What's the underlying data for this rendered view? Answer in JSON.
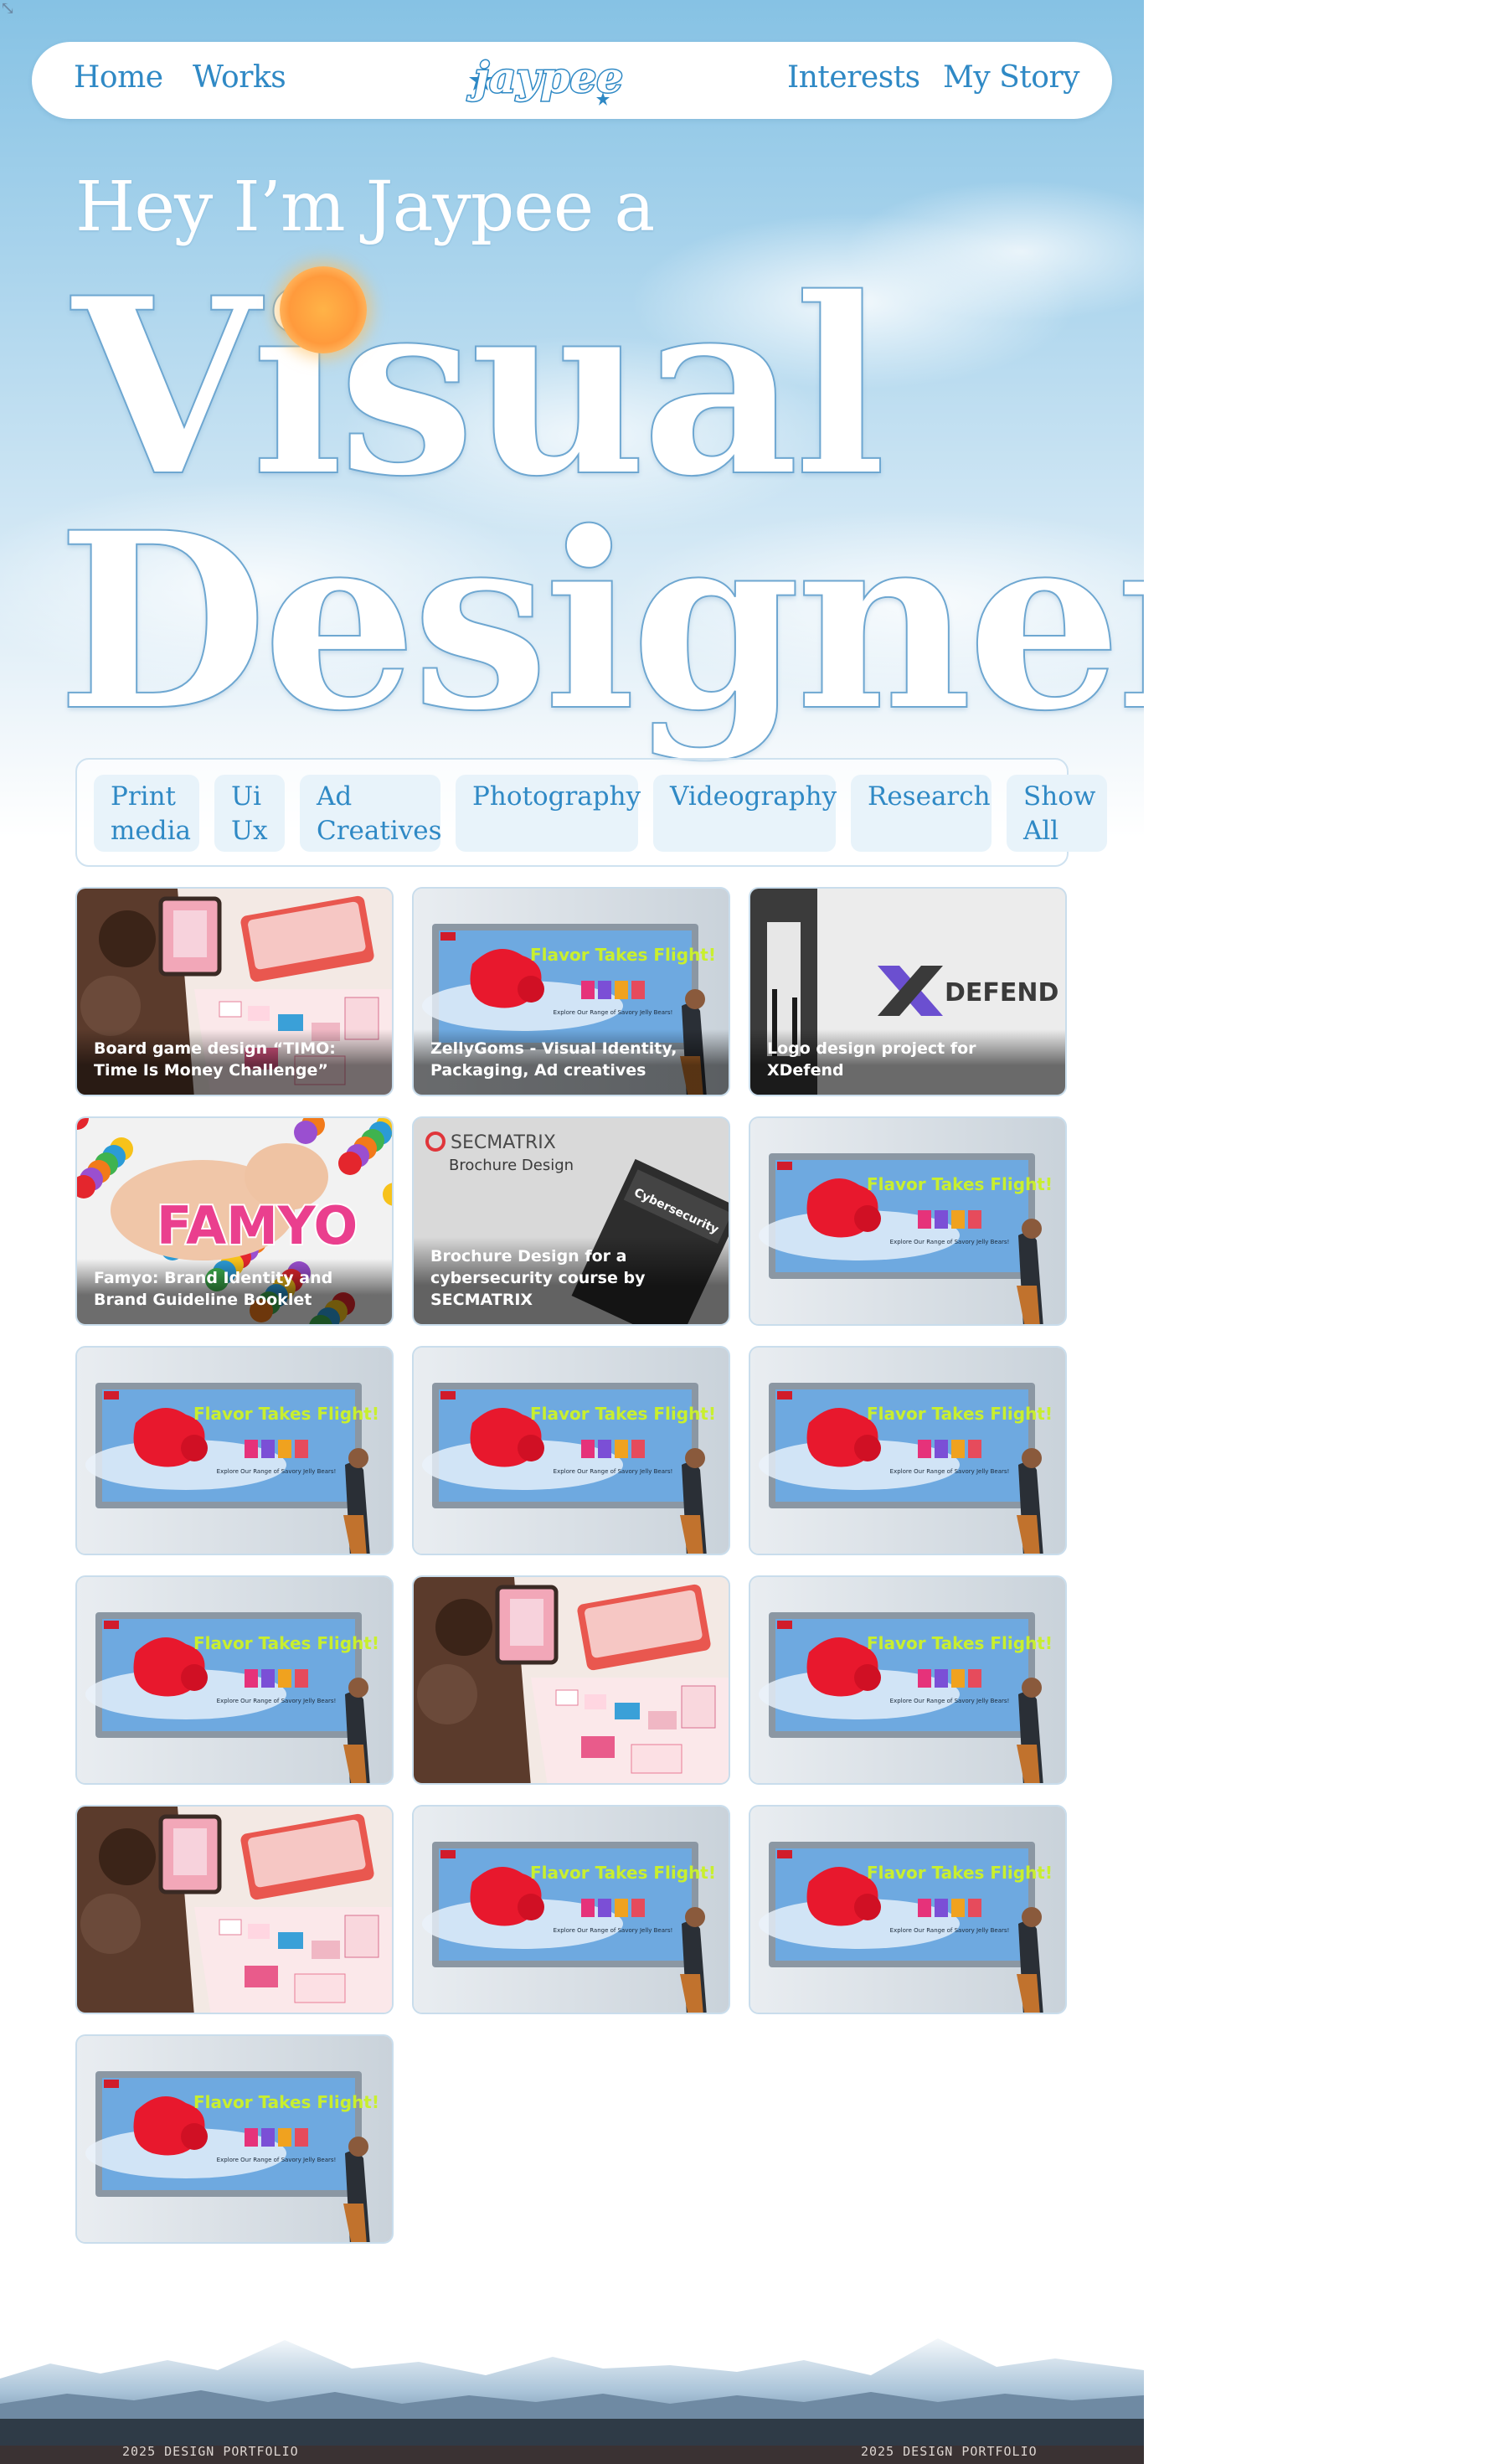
{
  "nav": {
    "links": [
      "Home",
      "Works",
      "Interests",
      "My Story"
    ],
    "logo_text": "jaypee"
  },
  "hero": {
    "intro": "Hey I’m Jaypee a",
    "line1": "Visual",
    "line2": "Designer"
  },
  "filters": [
    "Print media",
    "Ui Ux",
    "Ad Creatives",
    "Photography",
    "Videography",
    "Research",
    "Show All"
  ],
  "works": [
    {
      "caption": "Board game design “TIMO: Time Is Money Challenge”",
      "image": "board-game-photo"
    },
    {
      "caption": "ZellyGoms - Visual Identity, Packaging, Ad creatives",
      "image": "billboard-mockup"
    },
    {
      "caption": "Logo design project for XDefend",
      "image": "xdefend-wall-logo"
    },
    {
      "caption": "Famyo: Brand Identity and Brand Guideline Booklet",
      "image": "famyo-ball-pit"
    },
    {
      "caption": "Brochure Design for a cybersecurity course by SECMATRIX",
      "image": "secmatrix-brochure"
    },
    {
      "caption": "",
      "image": "billboard-mockup"
    },
    {
      "caption": "",
      "image": "billboard-mockup"
    },
    {
      "caption": "",
      "image": "billboard-mockup"
    },
    {
      "caption": "",
      "image": "billboard-mockup"
    },
    {
      "caption": "",
      "image": "billboard-mockup"
    },
    {
      "caption": "",
      "image": "board-game-photo"
    },
    {
      "caption": "",
      "image": "billboard-mockup"
    },
    {
      "caption": "",
      "image": "board-game-photo"
    },
    {
      "caption": "",
      "image": "billboard-mockup"
    },
    {
      "caption": "",
      "image": "billboard-mockup"
    },
    {
      "caption": "",
      "image": "billboard-mockup"
    }
  ],
  "image_text": {
    "billboard_headline": "Flavor Takes Flight!",
    "billboard_sub": "Explore Our Range of Savory Jelly Bears!",
    "xdefend": "DEFEND",
    "famyo": "FAMYO",
    "secmatrix_brand": "SECMATRIX",
    "secmatrix_sub": "Brochure Design",
    "secmatrix_book": "Cybersecurity"
  },
  "footer": {
    "left": "2025 DESIGN PORTFOLIO",
    "right": "2025 DESIGN PORTFOLIO"
  },
  "colors": {
    "accent": "#2f89c5",
    "chip_bg": "#e8f3fa",
    "sky_top": "#86c2e4",
    "footer_strip": "#3a3233"
  }
}
